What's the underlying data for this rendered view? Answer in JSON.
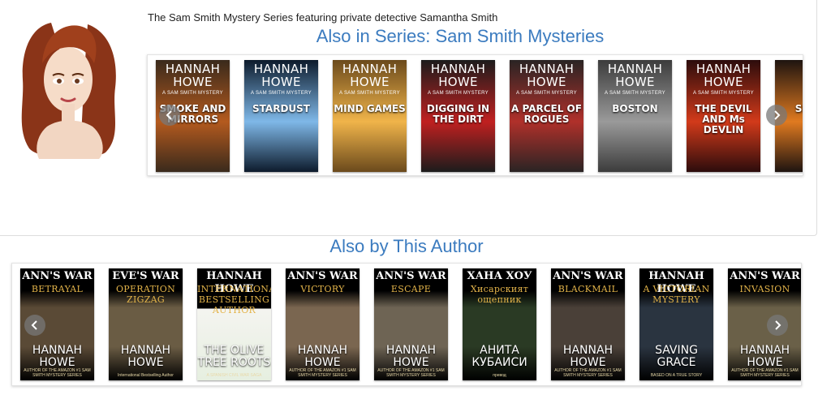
{
  "series": {
    "description": "The Sam Smith Mystery Series featuring private detective Samantha Smith",
    "heading": "Also in Series: Sam Smith Mysteries",
    "books": [
      {
        "top": "HANNAH HOWE",
        "sub": "A SAM SMITH MYSTERY",
        "title": "SMOKE AND MIRRORS",
        "bg": "#3a2a1c",
        "accent": "#b45a1e"
      },
      {
        "top": "HANNAH HOWE",
        "sub": "A SAM SMITH MYSTERY",
        "title": "STARDUST",
        "bg": "#0d1b2c",
        "accent": "#7fb8e8"
      },
      {
        "top": "HANNAH HOWE",
        "sub": "A SAM SMITH MYSTERY",
        "title": "MIND GAMES",
        "bg": "#6b4a1c",
        "accent": "#f0b44a"
      },
      {
        "top": "HANNAH HOWE",
        "sub": "A SAM SMITH MYSTERY",
        "title": "DIGGING IN THE DIRT",
        "bg": "#1c1c1c",
        "accent": "#c02020"
      },
      {
        "top": "HANNAH HOWE",
        "sub": "A SAM SMITH MYSTERY",
        "title": "A PARCEL OF ROGUES",
        "bg": "#2a2424",
        "accent": "#b0302a"
      },
      {
        "top": "HANNAH HOWE",
        "sub": "A SAM SMITH MYSTERY",
        "title": "BOSTON",
        "bg": "#3c3c3c",
        "accent": "#9a9a9a"
      },
      {
        "top": "HANNAH HOWE",
        "sub": "A SAM SMITH MYSTERY",
        "title": "THE DEVIL AND Ms DEVLIN",
        "bg": "#2c0c0c",
        "accent": "#d23a1a"
      },
      {
        "top": "HA",
        "sub": "A SAM",
        "title": "SN AU",
        "bg": "#1e1410",
        "accent": "#e07a20"
      }
    ]
  },
  "author": {
    "heading": "Also by This Author",
    "books": [
      {
        "band": "ANN'S WAR",
        "sub": "BETRAYAL",
        "bottom": "HANNAH HOWE",
        "tagline": "AUTHOR OF THE AMAZON #1 SAM SMITH MYSTERY SERIES",
        "bg": "#5a4a36"
      },
      {
        "band": "EVE'S WAR",
        "sub": "OPERATION ZIGZAG",
        "bottom": "HANNAH HOWE",
        "tagline": "International Bestselling Author",
        "bg": "#6a5c44"
      },
      {
        "band": "HANNAH HOWE",
        "sub": "INTERNATIONAL BESTSELLING AUTHOR",
        "bottom": "THE OLIVE TREE ROOTS",
        "tagline": "A SPANISH CIVIL WAR SAGA",
        "bg": "#f4f4f0"
      },
      {
        "band": "ANN'S WAR",
        "sub": "VICTORY",
        "bottom": "HANNAH HOWE",
        "tagline": "AUTHOR OF THE AMAZON #1 SAM SMITH MYSTERY SERIES",
        "bg": "#7a6650"
      },
      {
        "band": "ANN'S WAR",
        "sub": "ESCAPE",
        "bottom": "HANNAH HOWE",
        "tagline": "AUTHOR OF THE AMAZON #1 SAM SMITH MYSTERY SERIES",
        "bg": "#6e6454"
      },
      {
        "band": "ХАНА ХОУ",
        "sub": "Хисарският ощепник",
        "bottom": "АНИТА КУБАИСИ",
        "tagline": "превод",
        "bg": "#2a3a24"
      },
      {
        "band": "ANN'S WAR",
        "sub": "BLACKMAIL",
        "bottom": "HANNAH HOWE",
        "tagline": "AUTHOR OF THE AMAZON #1 SAM SMITH MYSTERY SERIES",
        "bg": "#4a4038"
      },
      {
        "band": "HANNAH HOWE",
        "sub": "A VICTORIAN MYSTERY",
        "bottom": "SAVING GRACE",
        "tagline": "BASED ON A TRUE STORY",
        "bg": "#2a3440"
      },
      {
        "band": "ANN'S WAR",
        "sub": "INVASION",
        "bottom": "HANNAH HOWE",
        "tagline": "AUTHOR OF THE AMAZON #1 SAM SMITH MYSTERY SERIES",
        "bg": "#6a6048"
      }
    ]
  },
  "icons": {
    "prev": "chevron-left-icon",
    "next": "chevron-right-icon"
  },
  "colors": {
    "heading": "#3b7bbf",
    "text": "#222222"
  }
}
